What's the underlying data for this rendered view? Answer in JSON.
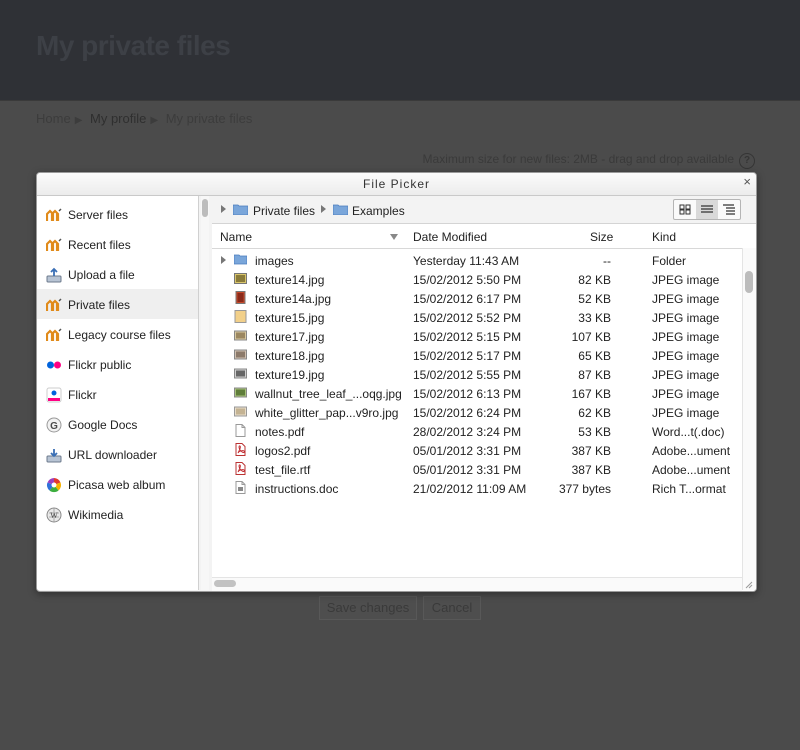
{
  "page": {
    "title": "My private files",
    "breadcrumb": [
      "Home",
      "My profile",
      "My private files"
    ],
    "max_size_text": "Maximum size for new files: 2MB - drag and drop available",
    "save_label": "Save changes",
    "cancel_label": "Cancel"
  },
  "dialog": {
    "title": "File Picker",
    "close_label": "×"
  },
  "sidebar": {
    "items": [
      {
        "label": "Server files",
        "icon": "moodle-icon"
      },
      {
        "label": "Recent files",
        "icon": "moodle-icon"
      },
      {
        "label": "Upload a file",
        "icon": "upload-icon"
      },
      {
        "label": "Private files",
        "icon": "moodle-icon",
        "active": true
      },
      {
        "label": "Legacy course files",
        "icon": "moodle-icon"
      },
      {
        "label": "Flickr public",
        "icon": "flickr-icon"
      },
      {
        "label": "Flickr",
        "icon": "flickr-icon"
      },
      {
        "label": "Google Docs",
        "icon": "google-icon"
      },
      {
        "label": "URL downloader",
        "icon": "download-icon"
      },
      {
        "label": "Picasa web album",
        "icon": "picasa-icon"
      },
      {
        "label": "Wikimedia",
        "icon": "wikimedia-icon"
      }
    ]
  },
  "path": {
    "segments": [
      "Private files",
      "Examples"
    ]
  },
  "columns": {
    "name": "Name",
    "date": "Date Modified",
    "size": "Size",
    "kind": "Kind"
  },
  "files": [
    {
      "name": "images",
      "date": "Yesterday 11:43 AM",
      "size": "--",
      "kind": "Folder",
      "icon": "folder-icon"
    },
    {
      "name": "texture14.jpg",
      "date": "15/02/2012 5:50 PM",
      "size": "82 KB",
      "kind": "JPEG image",
      "icon": "image-icon"
    },
    {
      "name": "texture14a.jpg",
      "date": "15/02/2012 6:17 PM",
      "size": "52 KB",
      "kind": "JPEG image",
      "icon": "image-icon"
    },
    {
      "name": "texture15.jpg",
      "date": "15/02/2012 5:52 PM",
      "size": "33 KB",
      "kind": "JPEG image",
      "icon": "image-icon"
    },
    {
      "name": "texture17.jpg",
      "date": "15/02/2012 5:15 PM",
      "size": "107 KB",
      "kind": "JPEG image",
      "icon": "image-icon"
    },
    {
      "name": "texture18.jpg",
      "date": "15/02/2012 5:17 PM",
      "size": "65 KB",
      "kind": "JPEG image",
      "icon": "image-icon"
    },
    {
      "name": "texture19.jpg",
      "date": "15/02/2012 5:55 PM",
      "size": "87 KB",
      "kind": "JPEG image",
      "icon": "image-icon"
    },
    {
      "name": "wallnut_tree_leaf_...oqg.jpg",
      "date": "15/02/2012 6:13 PM",
      "size": "167 KB",
      "kind": "JPEG image",
      "icon": "image-icon"
    },
    {
      "name": "white_glitter_pap...v9ro.jpg",
      "date": "15/02/2012 6:24 PM",
      "size": "62 KB",
      "kind": "JPEG image",
      "icon": "image-icon"
    },
    {
      "name": "notes.pdf",
      "date": "28/02/2012 3:24 PM",
      "size": "53 KB",
      "kind": "Word...t(.doc)",
      "icon": "document-icon"
    },
    {
      "name": "logos2.pdf",
      "date": "05/01/2012 3:31 PM",
      "size": "387 KB",
      "kind": "Adobe...ument",
      "icon": "pdf-icon"
    },
    {
      "name": "test_file.rtf",
      "date": "05/01/2012 3:31 PM",
      "size": "387 KB",
      "kind": "Adobe...ument",
      "icon": "pdf-icon"
    },
    {
      "name": "instructions.doc",
      "date": "21/02/2012 11:09 AM",
      "size": "377 bytes",
      "kind": "Rich T...ormat",
      "icon": "document-icon"
    }
  ]
}
